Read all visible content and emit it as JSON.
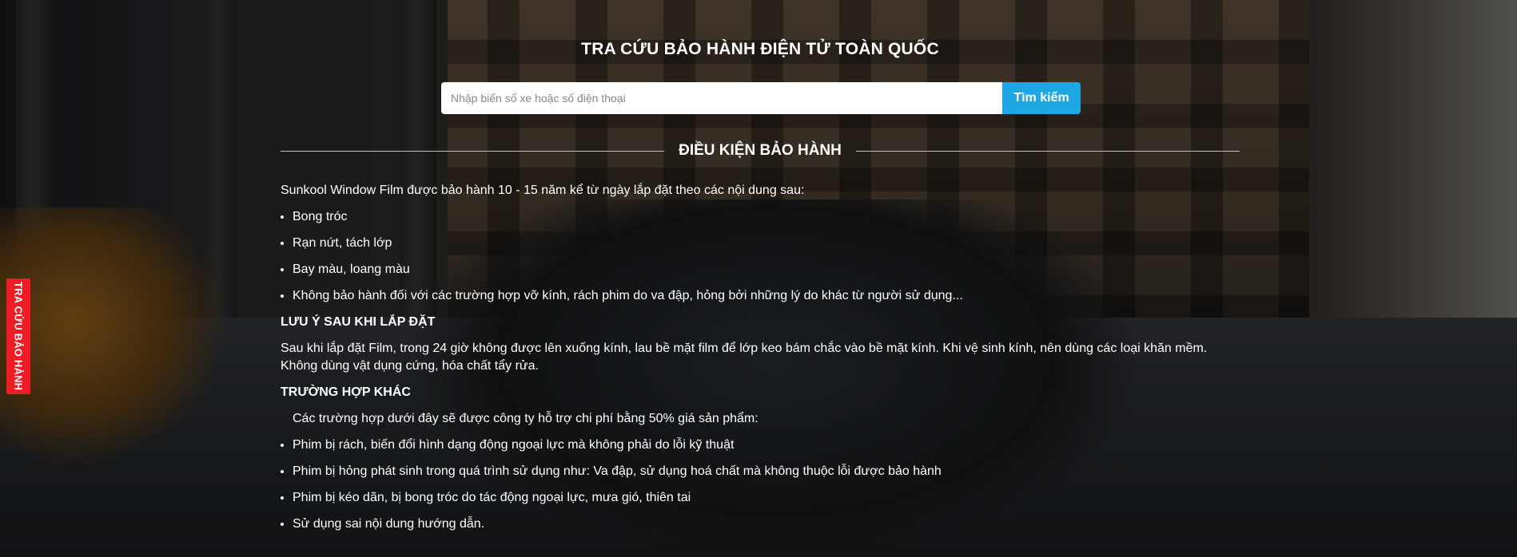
{
  "side_tab": {
    "label": "TRA CỨU BẢO HÀNH"
  },
  "header": {
    "title": "TRA CỨU BẢO HÀNH ĐIỆN TỬ TOÀN QUỐC"
  },
  "search": {
    "placeholder": "Nhập biển số xe hoặc số điện thoại",
    "button_label": "Tìm kiếm"
  },
  "section_title": "ĐIỀU KIỆN BẢO HÀNH",
  "warranty": {
    "intro": "Sunkool Window Film được bảo hành 10 - 15 năm kể từ ngày lắp đặt theo các nội dung sau:",
    "items": [
      "Bong tróc",
      "Rạn nứt, tách lớp",
      "Bay màu, loang màu",
      "Không bảo hành đối với các trường hợp vỡ kính, rách phim do va đập, hỏng bởi những lý do khác từ người sử dụng..."
    ]
  },
  "note": {
    "heading": "LƯU Ý SAU KHI LẮP ĐẶT",
    "text": "Sau khi lắp đặt Film, trong 24 giờ không được lên xuống kính, lau bề mặt film để lớp keo bám chắc vào bề mặt kính. Khi vệ sinh kính, nên dùng các loại khăn mềm. Không dùng vật dụng cứng, hóa chất tẩy rửa."
  },
  "other": {
    "heading": "TRƯỜNG HỢP KHÁC",
    "intro": "Các trường hợp dưới đây sẽ được công ty hỗ trợ chi phí bằng 50% giá sản phẩm:",
    "items": [
      "Phim bị rách, biến đổi hình dạng động ngoại lực mà không phải do lỗi kỹ thuật",
      "Phim bị hỏng phát sinh trong quá trình sử dụng như: Va đập, sử dụng hoá chất mà không thuộc lỗi được bảo hành",
      "Phim bị kéo dãn, bị bong tróc do tác động ngoại lực, mưa gió, thiên tai",
      "Sử dụng sai nội dung hướng dẫn."
    ]
  },
  "colors": {
    "accent_button": "#1ea7e4",
    "side_tab": "#ee1c25",
    "text": "#ffffff"
  }
}
